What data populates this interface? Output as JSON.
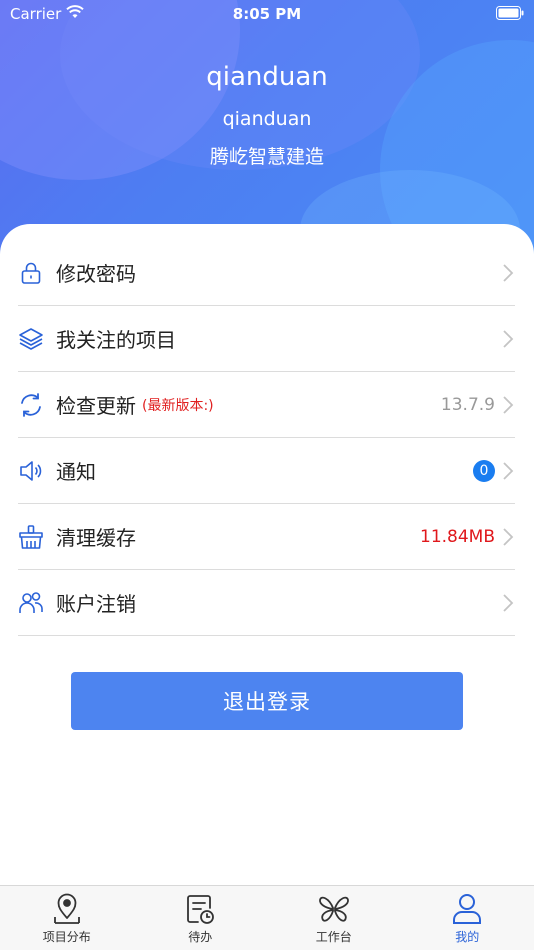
{
  "status_bar": {
    "carrier": "Carrier",
    "time": "8:05 PM"
  },
  "profile": {
    "name": "qianduan",
    "account": "qianduan",
    "company": "腾屹智慧建造"
  },
  "menu": {
    "items": [
      {
        "label": "修改密码",
        "icon": "lock-icon"
      },
      {
        "label": "我关注的项目",
        "icon": "layers-icon"
      },
      {
        "label": "检查更新",
        "sub": "(最新版本:)",
        "value": "13.7.9",
        "icon": "refresh-icon"
      },
      {
        "label": "通知",
        "badge": "0",
        "icon": "speaker-icon"
      },
      {
        "label": "清理缓存",
        "value": "11.84MB",
        "icon": "basket-icon"
      },
      {
        "label": "账户注销",
        "icon": "users-icon"
      }
    ]
  },
  "logout_label": "退出登录",
  "tabbar": {
    "tabs": [
      {
        "label": "项目分布",
        "icon": "map-pin-icon"
      },
      {
        "label": "待办",
        "icon": "todo-clock-icon"
      },
      {
        "label": "工作台",
        "icon": "butterfly-icon"
      },
      {
        "label": "我的",
        "icon": "person-icon",
        "active": true
      }
    ]
  },
  "colors": {
    "primary": "#4d84f0",
    "accent_red": "#e0181c",
    "badge_blue": "#1a7df0",
    "icon_blue": "#2a62d8"
  }
}
